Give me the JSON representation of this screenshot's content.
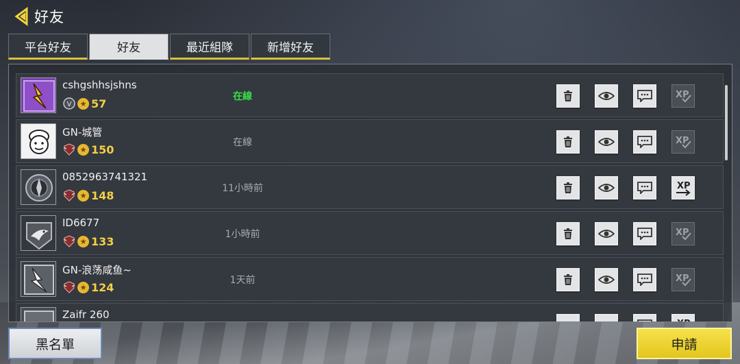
{
  "header": {
    "title": "好友"
  },
  "tabs": [
    {
      "label": "平台好友",
      "active": false
    },
    {
      "label": "好友",
      "active": true
    },
    {
      "label": "最近組隊",
      "active": false
    },
    {
      "label": "新增好友",
      "active": false
    }
  ],
  "friends": [
    {
      "name": "cshgshhsjshns",
      "level": "57",
      "status": "在線",
      "online": true,
      "xp_enabled": false
    },
    {
      "name": "GN-城管",
      "level": "150",
      "status": "在線",
      "online": false,
      "xp_enabled": false
    },
    {
      "name": "0852963741321",
      "level": "148",
      "status": "11小時前",
      "online": false,
      "xp_enabled": true
    },
    {
      "name": "ID6677",
      "level": "133",
      "status": "1小時前",
      "online": false,
      "xp_enabled": false
    },
    {
      "name": "GN-浪荡咸鱼~",
      "level": "124",
      "status": "1天前",
      "online": false,
      "xp_enabled": false
    },
    {
      "name": "Zaifr 260",
      "level": "",
      "status": "",
      "online": false,
      "xp_enabled": true
    }
  ],
  "footer": {
    "blacklist_label": "黑名單",
    "apply_label": "申請"
  },
  "colors": {
    "accent": "#f2cf45",
    "online": "#35e048",
    "apply": "#e8c92a"
  }
}
